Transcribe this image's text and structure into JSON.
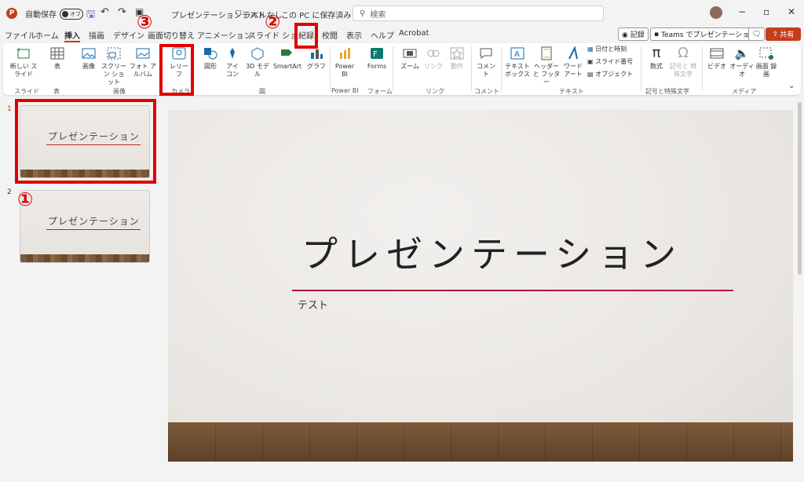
{
  "titlebar": {
    "autosave_label": "自動保存",
    "autosave_state": "オフ",
    "doc_title": "プレゼンテーションテスト",
    "label_status": "ラベルなし",
    "save_status": "この PC に保存済み ∨",
    "search_placeholder": "検索",
    "win_min": "−",
    "win_max": "▫",
    "win_close": "✕"
  },
  "tabs": [
    {
      "label": "ファイル"
    },
    {
      "label": "ホーム"
    },
    {
      "label": "挿入"
    },
    {
      "label": "描画"
    },
    {
      "label": "デザイン"
    },
    {
      "label": "画面切り替え"
    },
    {
      "label": "アニメーション"
    },
    {
      "label": "スライド ショー"
    },
    {
      "label": "記録"
    },
    {
      "label": "校閲"
    },
    {
      "label": "表示"
    },
    {
      "label": "ヘルプ"
    },
    {
      "label": "Acrobat"
    }
  ],
  "toolbar_right": {
    "record_btn": "◉ 記録",
    "teams_btn": "Teams でプレゼンテーション",
    "share_btn": "共有"
  },
  "ribbon": {
    "new_slide": "新しい スライド",
    "table": "表",
    "image": "画像",
    "screenshot": "スクリーン ショット",
    "photo_album": "フォト アルバム",
    "cameo": "レリー フ",
    "shapes": "図形",
    "icons": "アイ コン",
    "model3d": "3D モデル",
    "smartart": "SmartArt",
    "chart": "グラフ",
    "powerbi": "Power BI",
    "forms": "Forms",
    "zoom": "ズーム",
    "link": "リンク",
    "action": "動作",
    "comment": "コメント",
    "textbox": "テキスト ボックス",
    "header_footer": "ヘッダーと フッター",
    "wordart": "ワード アート",
    "date_time": "日付と時刻",
    "slide_number": "スライド番号",
    "object": "オブジェクト",
    "equation": "数式",
    "symbol": "記号と 特殊文字",
    "video": "ビデオ",
    "audio": "オーディオ",
    "screen_record": "画面 録画",
    "groups": {
      "slides": "スライド",
      "table": "表",
      "images": "画像",
      "camera": "カメラ",
      "illustrations": "図",
      "powerbi": "Power BI",
      "forms": "フォーム",
      "links": "リンク",
      "comments": "コメント",
      "text": "テキスト",
      "symbols": "記号と特殊文字",
      "media": "メディア"
    }
  },
  "thumbnails": [
    {
      "number": "1",
      "title": "プレゼンテーション"
    },
    {
      "number": "2",
      "title": "プレゼンテーション"
    }
  ],
  "slide": {
    "title": "プレゼンテーション",
    "subtitle": "テスト"
  },
  "annotations": {
    "one": "①",
    "two": "②",
    "three": "③"
  },
  "colors": {
    "accent": "#c43e1c",
    "highlight": "#e00000",
    "title_line": "#b8163a"
  }
}
